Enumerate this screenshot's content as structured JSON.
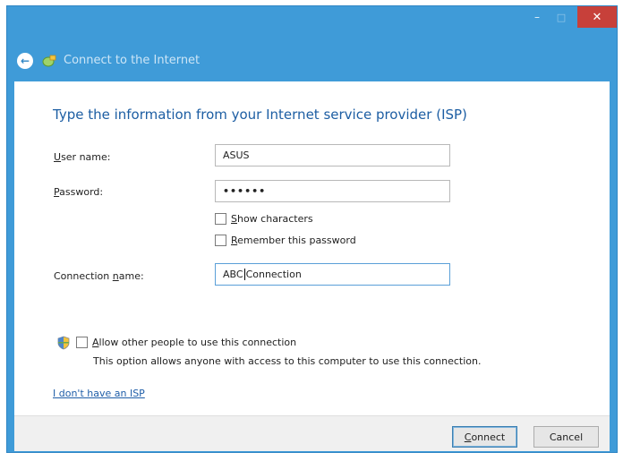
{
  "window": {
    "title": "Connect to the Internet",
    "close_glyph": "✕",
    "minimize_glyph": "–",
    "maximize_glyph": "□",
    "back_glyph": "←",
    "colors": {
      "frame": "#3f9bd8",
      "close": "#c7403a",
      "heading": "#1d5ea3",
      "link": "#1f5ea8"
    }
  },
  "form": {
    "heading": "Type the information from your Internet service provider (ISP)",
    "username": {
      "label_mnemonic": "U",
      "label_rest": "ser name:",
      "value": "ASUS"
    },
    "password": {
      "label_mnemonic": "P",
      "label_rest": "assword:",
      "value": "••••••"
    },
    "show_characters": {
      "mnemonic": "S",
      "rest": "how characters",
      "checked": false
    },
    "remember_password": {
      "mnemonic": "R",
      "rest": "emember this password",
      "checked": false
    },
    "connection_name": {
      "label_start": "Connection ",
      "label_mnemonic": "n",
      "label_rest": "ame:",
      "value_before_caret": "ABC",
      "value_after_caret": " Connection"
    },
    "allow_others": {
      "mnemonic": "A",
      "rest": "llow other people to use this connection",
      "checked": false
    },
    "allow_hint": "This option allows anyone with access to this computer to use this connection.",
    "no_isp_link": "I don't have an ISP"
  },
  "footer": {
    "connect_mnemonic": "C",
    "connect_rest": "onnect",
    "cancel": "Cancel"
  },
  "icons": [
    "back-arrow-icon",
    "globe-network-icon",
    "uac-shield-icon"
  ]
}
